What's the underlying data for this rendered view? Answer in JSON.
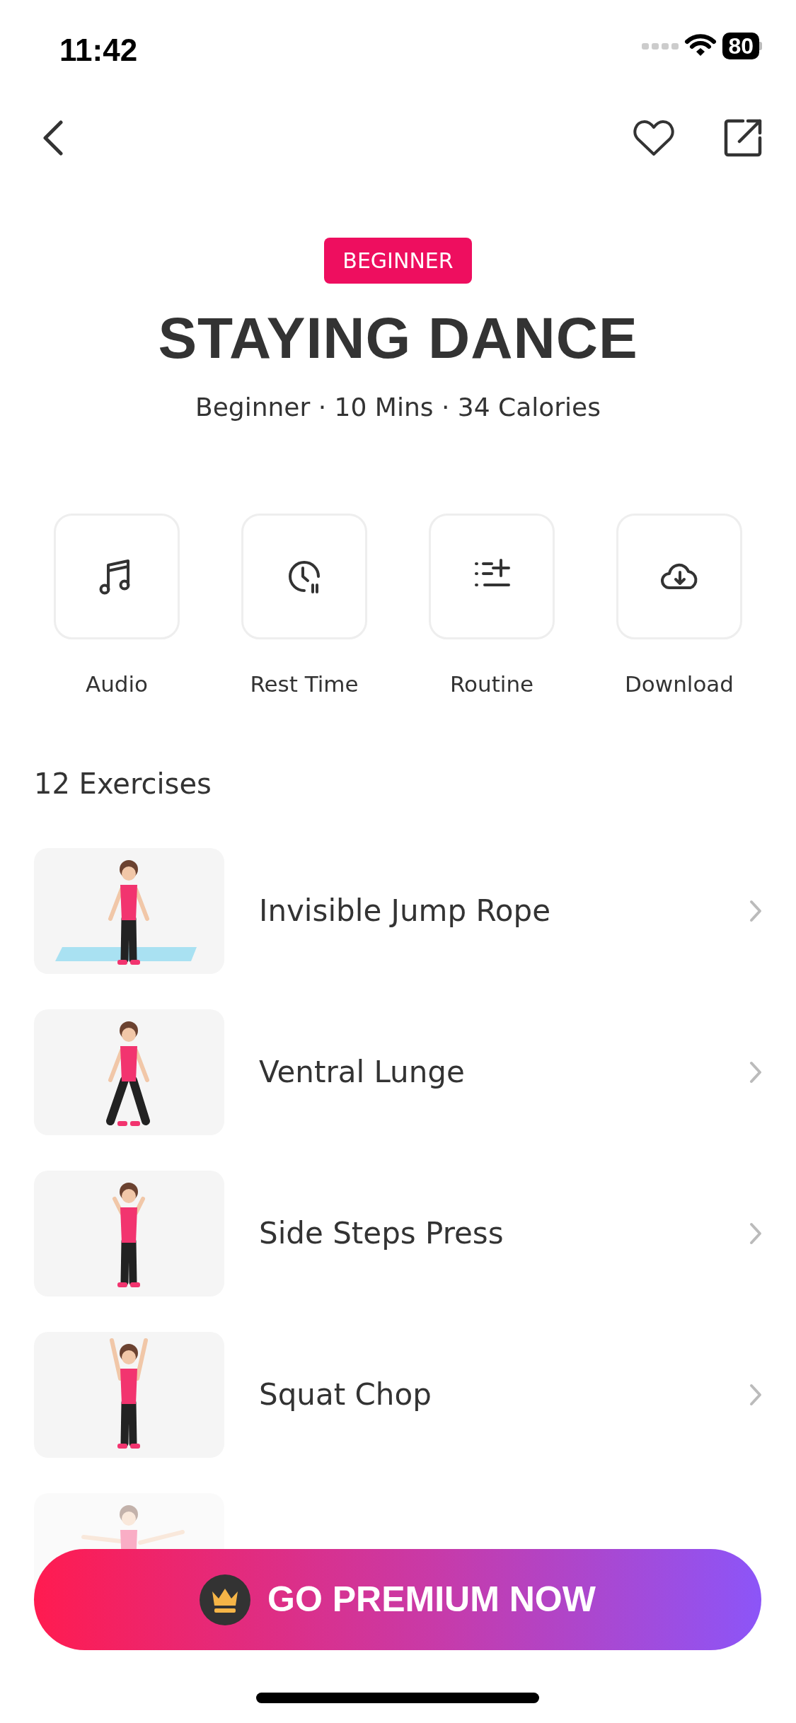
{
  "status_bar": {
    "time": "11:42",
    "battery": "80"
  },
  "level_badge": "BEGINNER",
  "title": "STAYING DANCE",
  "subtitle": "Beginner · 10 Mins · 34 Calories",
  "actions": [
    {
      "label": "Audio",
      "kind": "music"
    },
    {
      "label": "Rest Time",
      "kind": "timer"
    },
    {
      "label": "Routine",
      "kind": "list"
    },
    {
      "label": "Download",
      "kind": "download"
    }
  ],
  "exercises_heading": "12 Exercises",
  "exercises": [
    {
      "name": "Invisible Jump Rope",
      "kind": "mat"
    },
    {
      "name": "Ventral Lunge",
      "kind": "lunge"
    },
    {
      "name": "Side Steps Press",
      "kind": "stand"
    },
    {
      "name": "Squat Chop",
      "kind": "arms-up"
    },
    {
      "kind": "bend"
    }
  ],
  "premium_button": "GO PREMIUM NOW"
}
